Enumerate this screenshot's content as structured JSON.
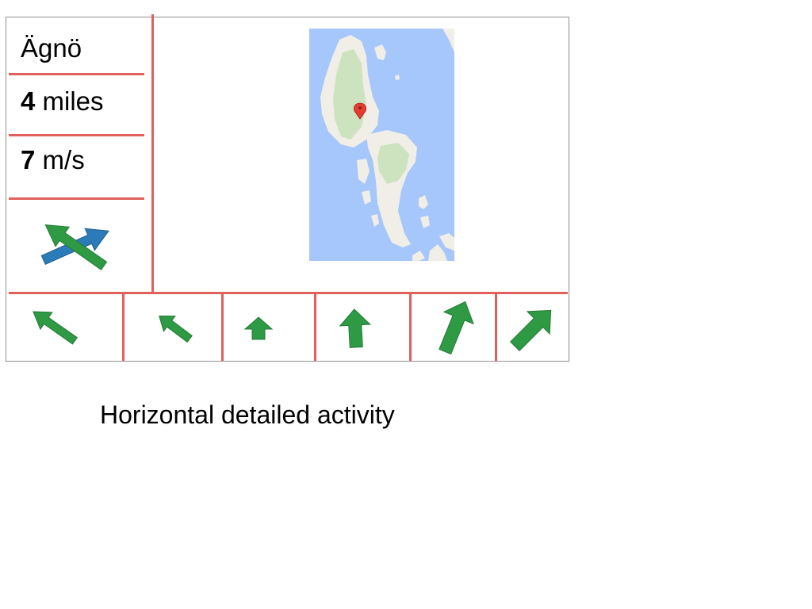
{
  "place": {
    "name": "Ägnö"
  },
  "distance": {
    "value": "4",
    "unit": "miles"
  },
  "wind": {
    "value": "7",
    "unit": "m/s"
  },
  "icons": {
    "wind_cross": "wind-vs-course-icon",
    "map_marker": "map-marker-icon"
  },
  "forecast": [
    {
      "icon": "arrow-northwest-icon"
    },
    {
      "icon": "arrow-northwest-icon"
    },
    {
      "icon": "arrow-north-icon"
    },
    {
      "icon": "arrow-north-icon"
    },
    {
      "icon": "arrow-northeast-icon"
    },
    {
      "icon": "arrow-northeast-icon"
    }
  ],
  "caption": "Horizontal detailed activity",
  "colors": {
    "divider": "#e0605c",
    "arrow_green": "#2e9a44",
    "arrow_blue": "#2b7bb9",
    "water": "#a5c7fb",
    "land": "#f0eee6",
    "park": "#cde3c0",
    "frame": "#8f8f8f"
  }
}
